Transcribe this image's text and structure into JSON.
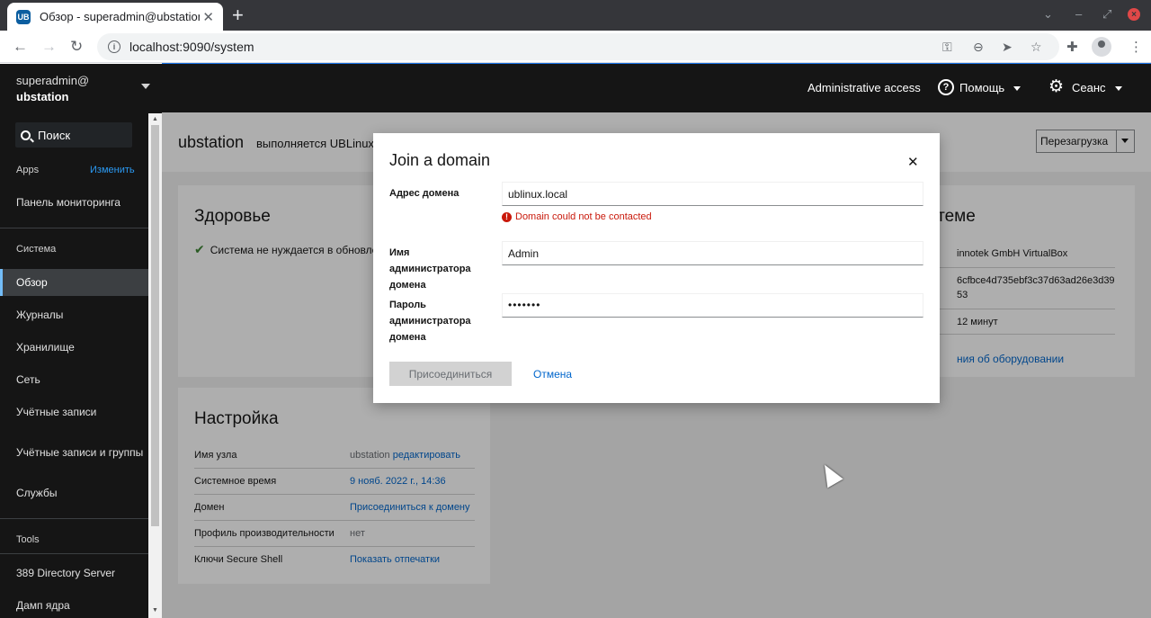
{
  "browser": {
    "tab_title": "Обзор - superadmin@ubstation",
    "tab_favicon": "UB",
    "url": "localhost:9090/system",
    "new_tab_icon": "+",
    "close_tab_icon": "✕"
  },
  "sidebar": {
    "user": "superadmin@",
    "host": "ubstation",
    "search_label": "Поиск",
    "apps_label": "Apps",
    "edit_label": "Изменить",
    "monitoring": "Панель мониторинга",
    "system_label": "Система",
    "items": [
      "Обзор",
      "Журналы",
      "Хранилище",
      "Сеть",
      "Учётные записи",
      "Учётные записи и группы",
      "Службы"
    ],
    "tools_label": "Tools",
    "tools": [
      "389 Directory Server",
      "Дамп ядра"
    ]
  },
  "masthead": {
    "admin_access": "Administrative access",
    "help": "Помощь",
    "session": "Сеанс"
  },
  "page": {
    "host": "ubstation",
    "running": "выполняется UBLinux",
    "restart": "Перезагрузка",
    "health_title": "Здоровье",
    "health_status": "Система не нуждается в обновлении",
    "config_title": "Настройка",
    "config_rows": [
      {
        "key": "Имя узла",
        "value": "ubstation",
        "link": "редактировать"
      },
      {
        "key": "Системное время",
        "value": "9 нояб. 2022 г., 14:36"
      },
      {
        "key": "Домен",
        "value": "Присоединиться к домену"
      },
      {
        "key": "Профиль производительности",
        "value": "нет"
      },
      {
        "key": "Ключи Secure Shell",
        "value": "Показать отпечатки"
      }
    ],
    "system_title": "истеме",
    "system_rows": [
      "innotek GmbH VirtualBox",
      "6cfbce4d735ebf3c37d63ad26e3d39",
      "53",
      "12 минут"
    ],
    "hardware_link": "ния об оборудовании"
  },
  "modal": {
    "title": "Join a domain",
    "domain_label": "Адрес домена",
    "domain_value": "ublinux.local",
    "error": "Domain could not be contacted",
    "admin_label_1": "Имя администратора",
    "admin_label_2": "домена",
    "admin_value": "Admin",
    "password_label_1": "Пароль",
    "password_label_2": "администратора",
    "password_label_3": "домена",
    "password_value": "•••••••",
    "join_button": "Присоединиться",
    "cancel": "Отмена"
  },
  "colors": {
    "accent": "#0066cc",
    "error": "#c9190b",
    "sidebar": "#151515"
  }
}
